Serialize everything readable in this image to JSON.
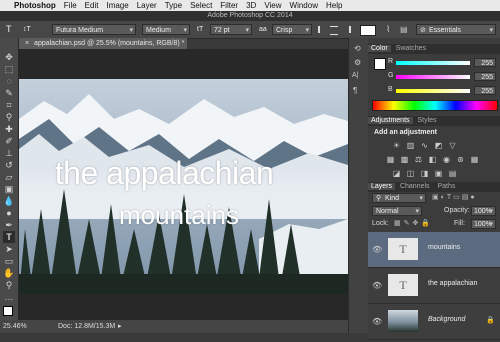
{
  "menubar": {
    "apple": "",
    "items": [
      "Photoshop",
      "File",
      "Edit",
      "Image",
      "Layer",
      "Type",
      "Select",
      "Filter",
      "3D",
      "View",
      "Window",
      "Help"
    ]
  },
  "window_title": "Adobe Photoshop CC 2014",
  "options_bar": {
    "tool_glyph": "T",
    "orientation_glyph": "↕T",
    "font_family": "Futura Medium",
    "font_style": "Medium",
    "size_glyph": "tT",
    "font_size": "72 pt",
    "aa_glyph": "aa",
    "antialias": "Crisp",
    "workspace": "Essentials"
  },
  "document_tab": {
    "title": "appalachian.psd @ 25.5% (mountains, RGB/8)",
    "modified_mark": "*",
    "close": "×"
  },
  "canvas": {
    "line1": "the appalachian",
    "line2": "mountains"
  },
  "status_bar": {
    "zoom": "25.46%",
    "doc_info": "Doc: 12.8M/15.3M"
  },
  "color_panel": {
    "tabs": [
      "Color",
      "Swatches"
    ],
    "channels": [
      {
        "label": "R",
        "value": "255"
      },
      {
        "label": "G",
        "value": "255"
      },
      {
        "label": "B",
        "value": "255"
      }
    ]
  },
  "adjustments_panel": {
    "tabs": [
      "Adjustments",
      "Styles"
    ],
    "heading": "Add an adjustment",
    "row1_icons": [
      "brightness-icon",
      "levels-icon",
      "curves-icon",
      "exposure-icon",
      "gradient-icon"
    ],
    "row2_icons": [
      "vibrance-icon",
      "hue-icon",
      "color-balance-icon",
      "bw-icon",
      "photo-filter-icon",
      "channel-mixer-icon",
      "lookup-icon"
    ],
    "row3_icons": [
      "invert-icon",
      "posterize-icon",
      "threshold-icon",
      "selective-color-icon",
      "gradient-map-icon"
    ]
  },
  "layers_panel": {
    "tabs": [
      "Layers",
      "Channels",
      "Paths"
    ],
    "filter": "Kind",
    "blend_mode": "Normal",
    "opacity_label": "Opacity:",
    "opacity": "100%",
    "lock_label": "Lock:",
    "fill_label": "Fill:",
    "fill": "100%",
    "layers": [
      {
        "name": "mountains",
        "kind": "text",
        "thumb": "T",
        "selected": true
      },
      {
        "name": "the appalachian",
        "kind": "text",
        "thumb": "T",
        "selected": false
      },
      {
        "name": "Background",
        "kind": "image",
        "thumb": "",
        "selected": false
      }
    ]
  },
  "colors": {
    "selected_layer": "#5d6b80",
    "panel_bg": "#3c3c3c"
  }
}
